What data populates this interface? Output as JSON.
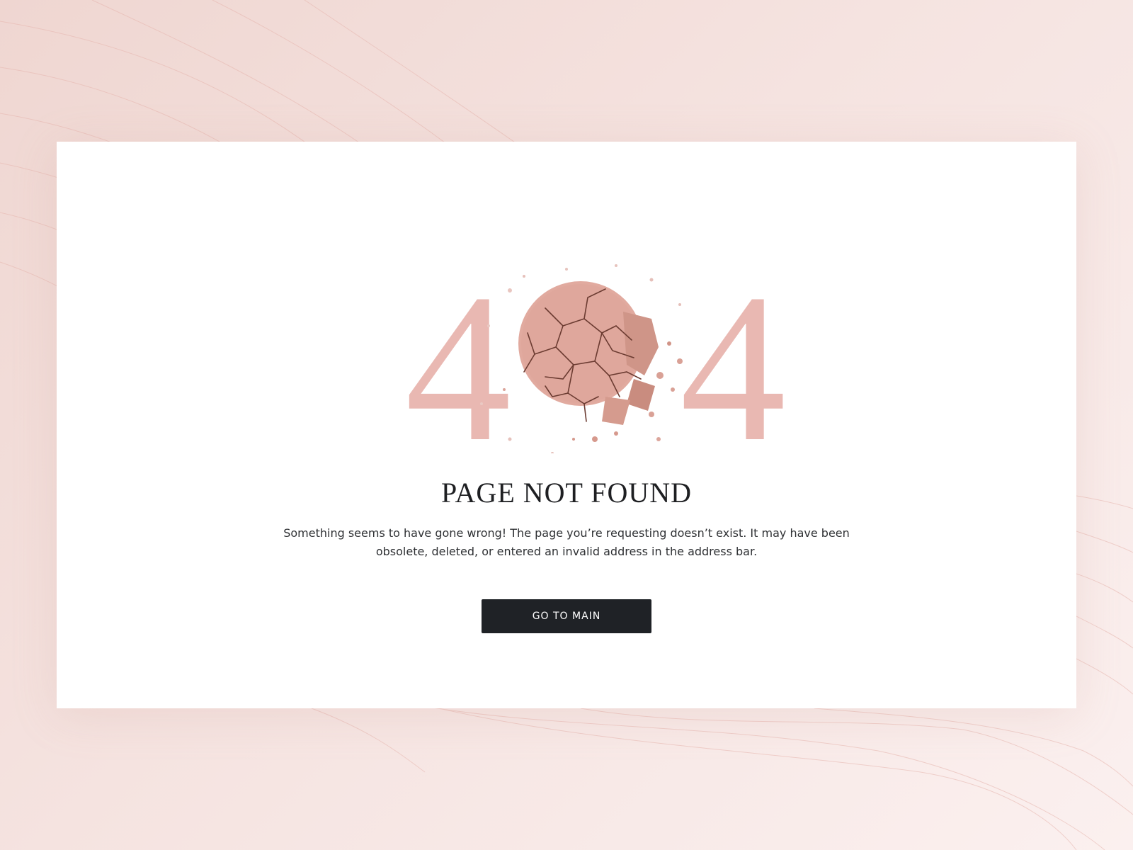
{
  "page": {
    "code_digits": [
      "4",
      "4"
    ],
    "title": "PAGE NOT FOUND",
    "message": "Something seems to have gone wrong! The page you’re requesting doesn’t exist. It may have been obsolete, deleted, or entered an invalid address in the address bar.",
    "button_label": "GO TO MAIN"
  },
  "colors": {
    "accent_pink": "#e9b8b2",
    "powder": "#d9a196",
    "button_bg": "#1f2226",
    "button_text": "#ffffff",
    "title_text": "#1e1f22"
  },
  "icons": {
    "illustration": "crushed-powder-compact"
  }
}
